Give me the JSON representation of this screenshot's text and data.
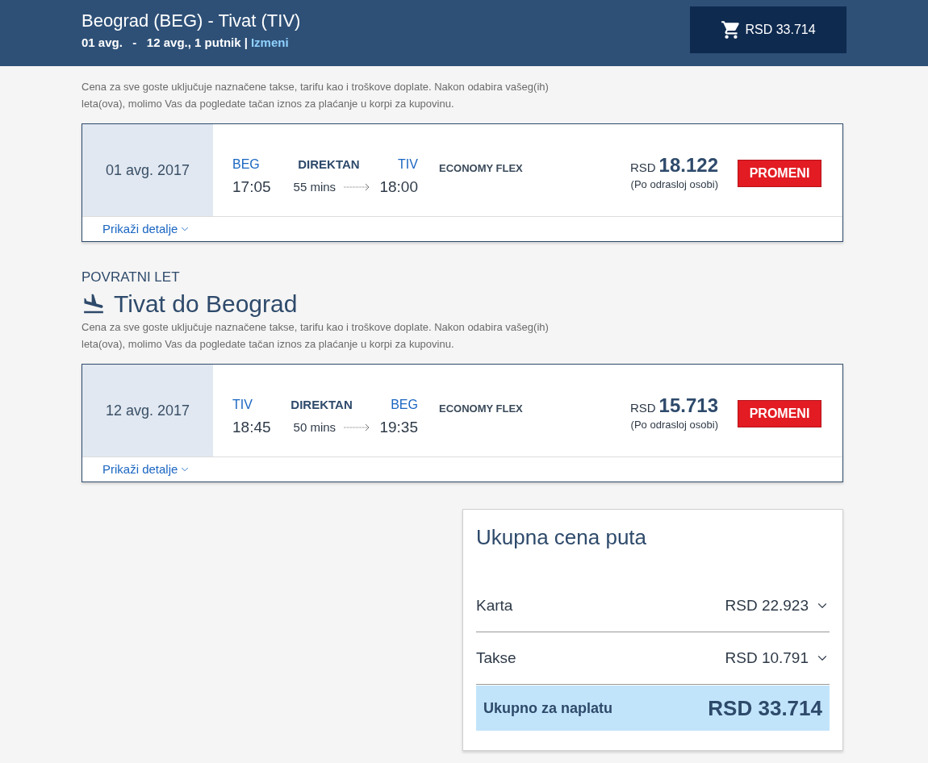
{
  "header": {
    "route": "Beograd (BEG) - Tivat (TIV)",
    "dates": "01 avg.   -   12 avg., 1 putnik |",
    "edit_link": "Izmeni",
    "cart_total": "RSD 33.714"
  },
  "legs": [
    {
      "description": "Cena za sve goste uključuje naznačene takse, tarifu kao i troškove doplate. Nakon odabira vašeg(ih) leta(ova), molimo Vas da pogledate tačan iznos za plaćanje u korpi za kupovinu.",
      "date": "01 avg. 2017",
      "from": "BEG",
      "to": "TIV",
      "departure": "17:05",
      "arrival": "18:00",
      "stops": "DIREKTAN",
      "duration": "55 mins",
      "fare_class": "ECONOMY FLEX",
      "currency": "RSD",
      "price": "18.122",
      "price_note": "(Po odrasloj osobi)",
      "change_button": "PROMENI",
      "details_link": "Prikaži detalje"
    },
    {
      "label": "POVRATNI LET",
      "heading": "Tivat do Beograd",
      "description": "Cena za sve goste uključuje naznačene takse, tarifu kao i troškove doplate. Nakon odabira vašeg(ih) leta(ova), molimo Vas da pogledate tačan iznos za plaćanje u korpi za kupovinu.",
      "date": "12 avg. 2017",
      "from": "TIV",
      "to": "BEG",
      "departure": "18:45",
      "arrival": "19:35",
      "stops": "DIREKTAN",
      "duration": "50 mins",
      "fare_class": "ECONOMY FLEX",
      "currency": "RSD",
      "price": "15.713",
      "price_note": "(Po odrasloj osobi)",
      "change_button": "PROMENI",
      "details_link": "Prikaži detalje"
    }
  ],
  "summary": {
    "title": "Ukupna cena puta",
    "rows": [
      {
        "label": "Karta",
        "amount": "RSD 22.923",
        "expanded": false
      },
      {
        "label": "Takse",
        "amount": "RSD 10.791",
        "expanded": false
      }
    ],
    "total": {
      "label": "Ukupno za naplatu",
      "amount": "RSD 33.714"
    }
  }
}
